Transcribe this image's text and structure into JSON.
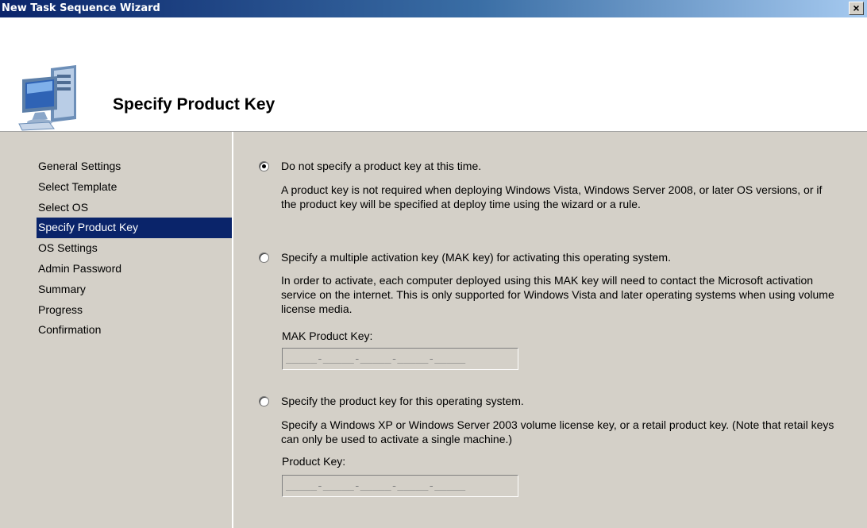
{
  "window": {
    "title": "New Task Sequence Wizard",
    "close_glyph": "×"
  },
  "header": {
    "title": "Specify Product Key",
    "icon": "computer-icon"
  },
  "sidebar": {
    "items": [
      {
        "label": "General Settings",
        "active": false
      },
      {
        "label": "Select Template",
        "active": false
      },
      {
        "label": "Select OS",
        "active": false
      },
      {
        "label": "Specify Product Key",
        "active": true
      },
      {
        "label": "OS Settings",
        "active": false
      },
      {
        "label": "Admin Password",
        "active": false
      },
      {
        "label": "Summary",
        "active": false
      },
      {
        "label": "Progress",
        "active": false
      },
      {
        "label": "Confirmation",
        "active": false
      }
    ]
  },
  "options": [
    {
      "label": "Do not specify a product key at this time.",
      "selected": true,
      "description": "A product key is not required when deploying Windows Vista, Windows Server 2008, or later OS versions, or if the product key will be specified at deploy time using the wizard or a rule."
    },
    {
      "label": "Specify a multiple activation key (MAK key) for activating this operating system.",
      "selected": false,
      "description": "In order to activate, each computer deployed using this MAK key will need to contact the Microsoft activation service on the internet.  This is only supported for Windows Vista and later operating systems when using volume license media.",
      "field_label": "MAK Product Key:",
      "field_mask": "_____-_____-_____-_____-_____"
    },
    {
      "label": "Specify the product key for this operating system.",
      "selected": false,
      "description": "Specify a Windows XP or Windows Server 2003 volume license key, or a retail product key.  (Note that retail keys can only be used to activate a single machine.)",
      "field_label": "Product Key:",
      "field_mask": "_____-_____-_____-_____-_____"
    }
  ],
  "colors": {
    "dialog_bg": "#d4d0c8",
    "selection": "#0a246a",
    "titlebar_start": "#0a246a",
    "titlebar_end": "#a6caf0"
  }
}
